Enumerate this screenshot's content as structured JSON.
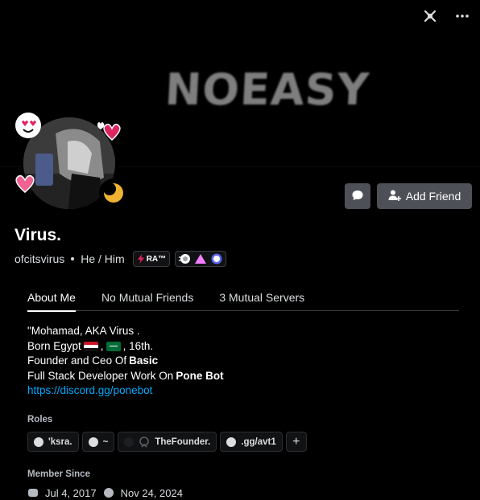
{
  "banner": {
    "art_text": "NOEASY"
  },
  "top_icons": {
    "left": "no-voice-icon",
    "right": "more-options-icon"
  },
  "profile": {
    "display_name": "Virus.",
    "username": "ofcitsvirus",
    "pronouns": "He / Him",
    "guild_tag": "RA™",
    "status": "idle"
  },
  "actions": {
    "message_icon": "message-bubble-icon",
    "add_friend_label": "Add Friend"
  },
  "tabs": [
    {
      "label": "About Me"
    },
    {
      "label": "No Mutual Friends"
    },
    {
      "label": "3 Mutual Servers"
    }
  ],
  "bio": {
    "line1": "\"Mohamad, AKA Virus .",
    "line2_a": "Born Egypt",
    "line2_b": ",",
    "line2_c": ", 16th.",
    "line3_a": "Founder and Ceo Of",
    "line3_b": "Basic",
    "line4_a": "Full Stack Developer Work On",
    "line4_b": "Pone Bot",
    "link": "https://discord.gg/ponebot"
  },
  "roles_section": {
    "label": "Roles",
    "roles": [
      {
        "name": "'ksra."
      },
      {
        "name": "~"
      },
      {
        "name": "TheFounder."
      },
      {
        "name": ".gg/avt1"
      }
    ],
    "add_label": "+"
  },
  "member_since": {
    "label": "Member Since",
    "discord_date": "Jul 4, 2017",
    "server_date": "Nov 24, 2024"
  },
  "colors": {
    "accent_link": "#00a8fc",
    "button": "#4e5058",
    "idle": "#f0b232"
  }
}
